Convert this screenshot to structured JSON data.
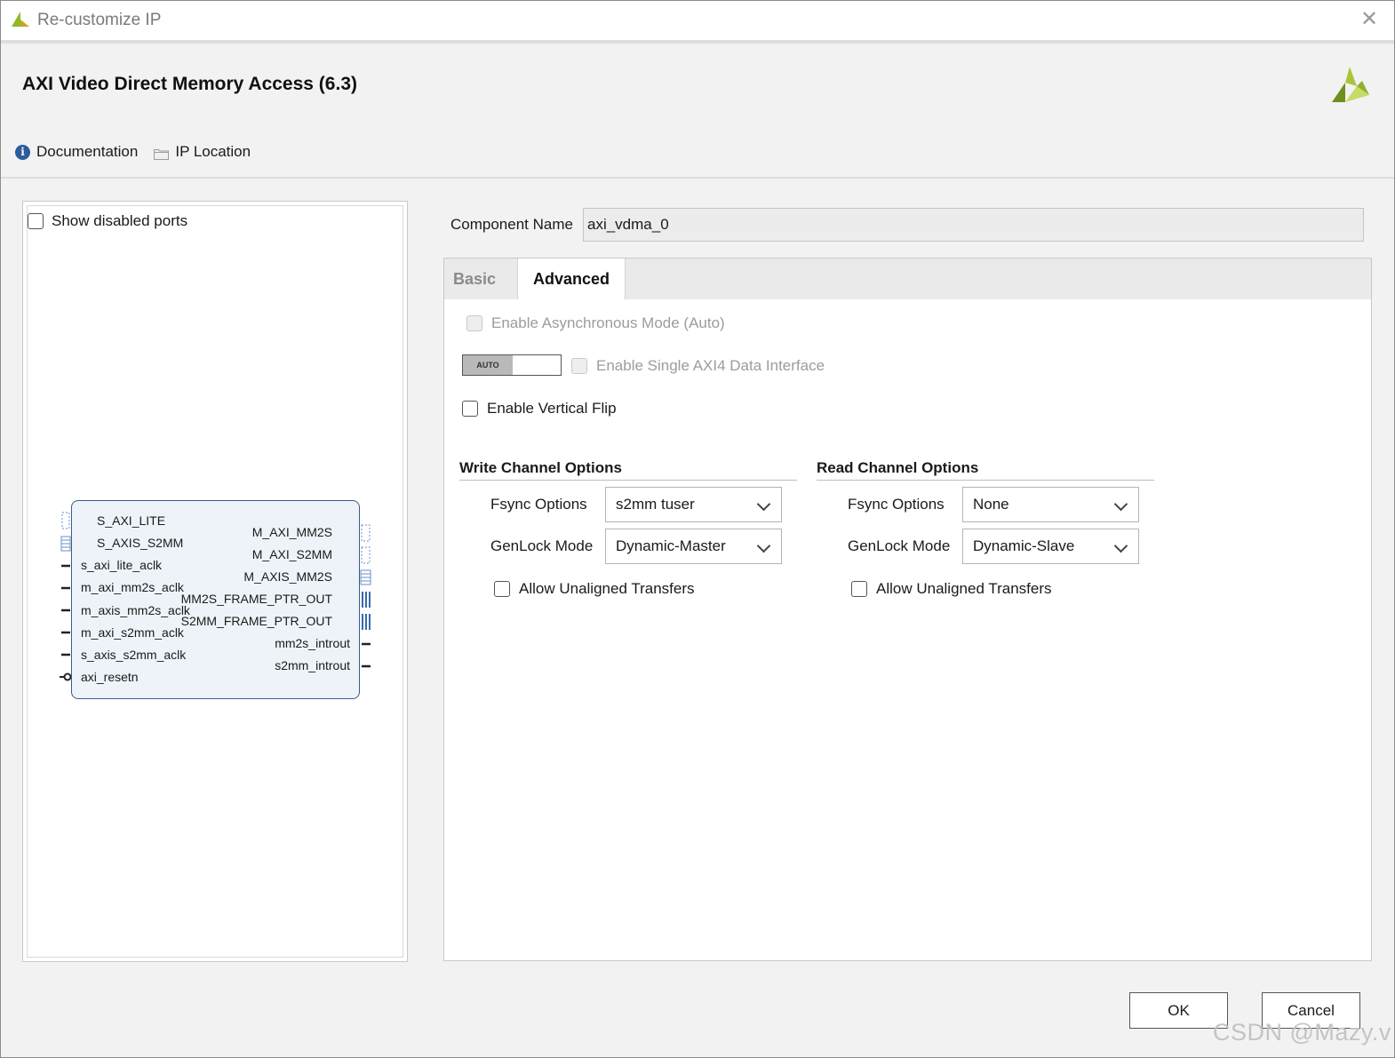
{
  "window": {
    "title": "Re-customize IP",
    "close_label": "✕"
  },
  "header": {
    "ip_title": "AXI Video Direct Memory Access (6.3)",
    "links": {
      "documentation": "Documentation",
      "ip_location": "IP Location"
    }
  },
  "left_panel": {
    "show_disabled_ports": {
      "label": "Show disabled ports",
      "checked": false
    },
    "block": {
      "left_ports": [
        "S_AXI_LITE",
        "S_AXIS_S2MM",
        "s_axi_lite_aclk",
        "m_axi_mm2s_aclk",
        "m_axis_mm2s_aclk",
        "m_axi_s2mm_aclk",
        "s_axis_s2mm_aclk",
        "axi_resetn"
      ],
      "right_ports": [
        "M_AXI_MM2S",
        "M_AXI_S2MM",
        "M_AXIS_MM2S",
        "MM2S_FRAME_PTR_OUT",
        "S2MM_FRAME_PTR_OUT",
        "mm2s_introut",
        "s2mm_introut"
      ]
    }
  },
  "component": {
    "label": "Component Name",
    "value": "axi_vdma_0"
  },
  "tabs": {
    "basic": "Basic",
    "advanced": "Advanced",
    "active": "Advanced"
  },
  "advanced": {
    "async_mode": {
      "label": "Enable Asynchronous Mode (Auto)",
      "checked": false,
      "enabled": false
    },
    "auto_badge": "AUTO",
    "single_axi4": {
      "label": "Enable Single AXI4 Data Interface",
      "checked": false,
      "enabled": false
    },
    "vertical_flip": {
      "label": "Enable Vertical Flip",
      "checked": false
    },
    "write_channel": {
      "title": "Write Channel Options",
      "fsync_label": "Fsync Options",
      "fsync_value": "s2mm tuser",
      "genlock_label": "GenLock Mode",
      "genlock_value": "Dynamic-Master",
      "unaligned_label": "Allow Unaligned Transfers",
      "unaligned_checked": false
    },
    "read_channel": {
      "title": "Read Channel Options",
      "fsync_label": "Fsync Options",
      "fsync_value": "None",
      "genlock_label": "GenLock Mode",
      "genlock_value": "Dynamic-Slave",
      "unaligned_label": "Allow Unaligned Transfers",
      "unaligned_checked": false
    }
  },
  "buttons": {
    "ok": "OK",
    "cancel": "Cancel"
  },
  "watermark": "CSDN @Mazy.v",
  "colors": {
    "accent_blue": "#2e5b9a",
    "block_border": "#3a5c8a",
    "logo_green": "#8dbb25"
  }
}
